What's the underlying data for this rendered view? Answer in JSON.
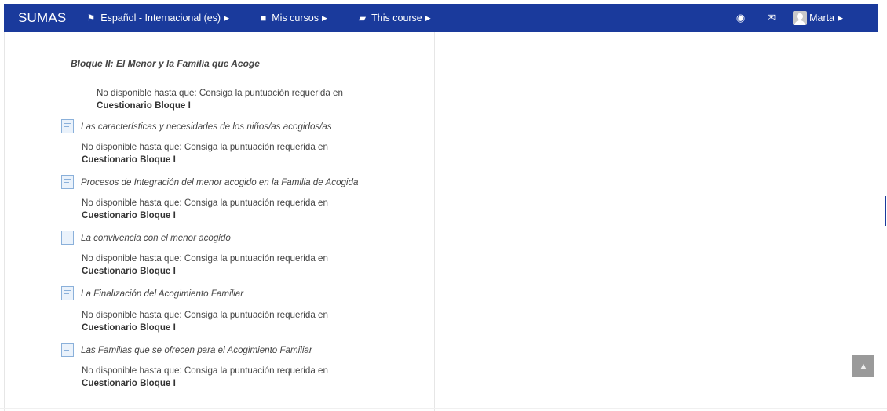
{
  "navbar": {
    "brand": "SUMAS",
    "language": "Español - Internacional (es)",
    "my_courses": "Mis cursos",
    "this_course": "This course",
    "user_name": "Marta",
    "color": "#1a3a9c"
  },
  "section": {
    "title": "Bloque II: El Menor y la Familia que Acoge",
    "restriction_text": "No disponible hasta que: Consiga la puntuación requerida en",
    "restriction_bold": "Cuestionario Bloque I"
  },
  "activities": [
    {
      "name": "Las características y necesidades de los niños/as acogidos/as",
      "restriction_text": "No disponible hasta que: Consiga la puntuación requerida en",
      "restriction_bold": "Cuestionario Bloque I"
    },
    {
      "name": "Procesos de Integración del menor acogido en la Familia de Acogida",
      "restriction_text": "No disponible hasta que: Consiga la puntuación requerida en",
      "restriction_bold": "Cuestionario Bloque I"
    },
    {
      "name": "La convivencia con el menor acogido",
      "restriction_text": "No disponible hasta que: Consiga la puntuación requerida en",
      "restriction_bold": "Cuestionario Bloque I"
    },
    {
      "name": "La Finalización del Acogimiento Familiar",
      "restriction_text": "No disponible hasta que: Consiga la puntuación requerida en",
      "restriction_bold": "Cuestionario Bloque I"
    },
    {
      "name": "Las Familias que se ofrecen para el Acogimiento Familiar",
      "restriction_text": "No disponible hasta que: Consiga la puntuación requerida en",
      "restriction_bold": "Cuestionario Bloque I"
    }
  ],
  "icons": {
    "language": "flag-icon",
    "courses": "briefcase-icon",
    "this_course": "book-icon",
    "target": "target-icon",
    "messages": "envelope-icon",
    "back_to_top": "chevron-up-icon"
  }
}
